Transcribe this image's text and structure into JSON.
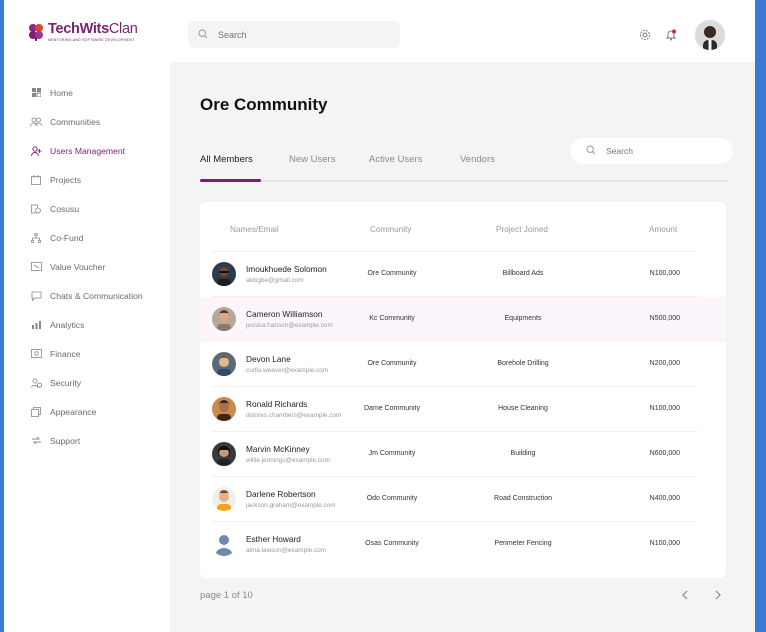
{
  "brand": {
    "name_part1": "TechWits",
    "name_part2": "Clan",
    "tagline": "MENTORING AND SOFTWARE DEVELOPMENT",
    "accent": "#7a1f72"
  },
  "header": {
    "search_placeholder": "Search"
  },
  "sidebar": {
    "items": [
      {
        "label": "Home",
        "icon": "grid-icon"
      },
      {
        "label": "Communities",
        "icon": "people-icon"
      },
      {
        "label": "Users Management",
        "icon": "user-add-icon",
        "active": true
      },
      {
        "label": "Projects",
        "icon": "calendar-icon"
      },
      {
        "label": "Cosusu",
        "icon": "money-icon"
      },
      {
        "label": "Co-Fund",
        "icon": "hierarchy-icon"
      },
      {
        "label": "Value Voucher",
        "icon": "voucher-icon"
      },
      {
        "label": "Chats & Communication",
        "icon": "chat-icon"
      },
      {
        "label": "Analytics",
        "icon": "chart-icon"
      },
      {
        "label": "Finance",
        "icon": "wallet-icon"
      },
      {
        "label": "Security",
        "icon": "security-icon"
      },
      {
        "label": "Appearance",
        "icon": "layers-icon"
      },
      {
        "label": "Support",
        "icon": "support-icon"
      }
    ]
  },
  "main": {
    "title": "Ore Community",
    "tabs": [
      {
        "label": "All Members",
        "active": true
      },
      {
        "label": "New Users"
      },
      {
        "label": "Active Users"
      },
      {
        "label": "Vendors"
      }
    ],
    "search_placeholder": "Search",
    "table": {
      "columns": [
        "Names/Email",
        "Community",
        "Project Joined",
        "Amount"
      ],
      "rows": [
        {
          "name": "Imoukhuede Solomon",
          "email": "akitigbe@gmail.com",
          "community": "Ore Community",
          "project": "Billboard Ads",
          "amount": "N100,000"
        },
        {
          "name": "Cameron Williamson",
          "email": "jessica.hanson@example.com",
          "community": "Kc Community",
          "project": "Equipments",
          "amount": "N500,000"
        },
        {
          "name": "Devon Lane",
          "email": "curtis.weaver@example.com",
          "community": "Ore Community",
          "project": "Borehole Drilling",
          "amount": "N200,000"
        },
        {
          "name": "Ronald Richards",
          "email": "dolores.chambers@example.com",
          "community": "Dame Community",
          "project": "House Cleaning",
          "amount": "N100,000"
        },
        {
          "name": "Marvin McKinney",
          "email": "willie.jennings@example.com",
          "community": "Jm Community",
          "project": "Building",
          "amount": "N600,000"
        },
        {
          "name": "Darlene Robertson",
          "email": "jackson.graham@example.com",
          "community": "Odo Community",
          "project": "Road Construction",
          "amount": "N400,000"
        },
        {
          "name": "Esther Howard",
          "email": "alma.lawson@example.com",
          "community": "Osas Community",
          "project": "Perimeter Fencing",
          "amount": "N100,000"
        }
      ]
    },
    "pager": {
      "text": "page 1 of 10"
    }
  }
}
